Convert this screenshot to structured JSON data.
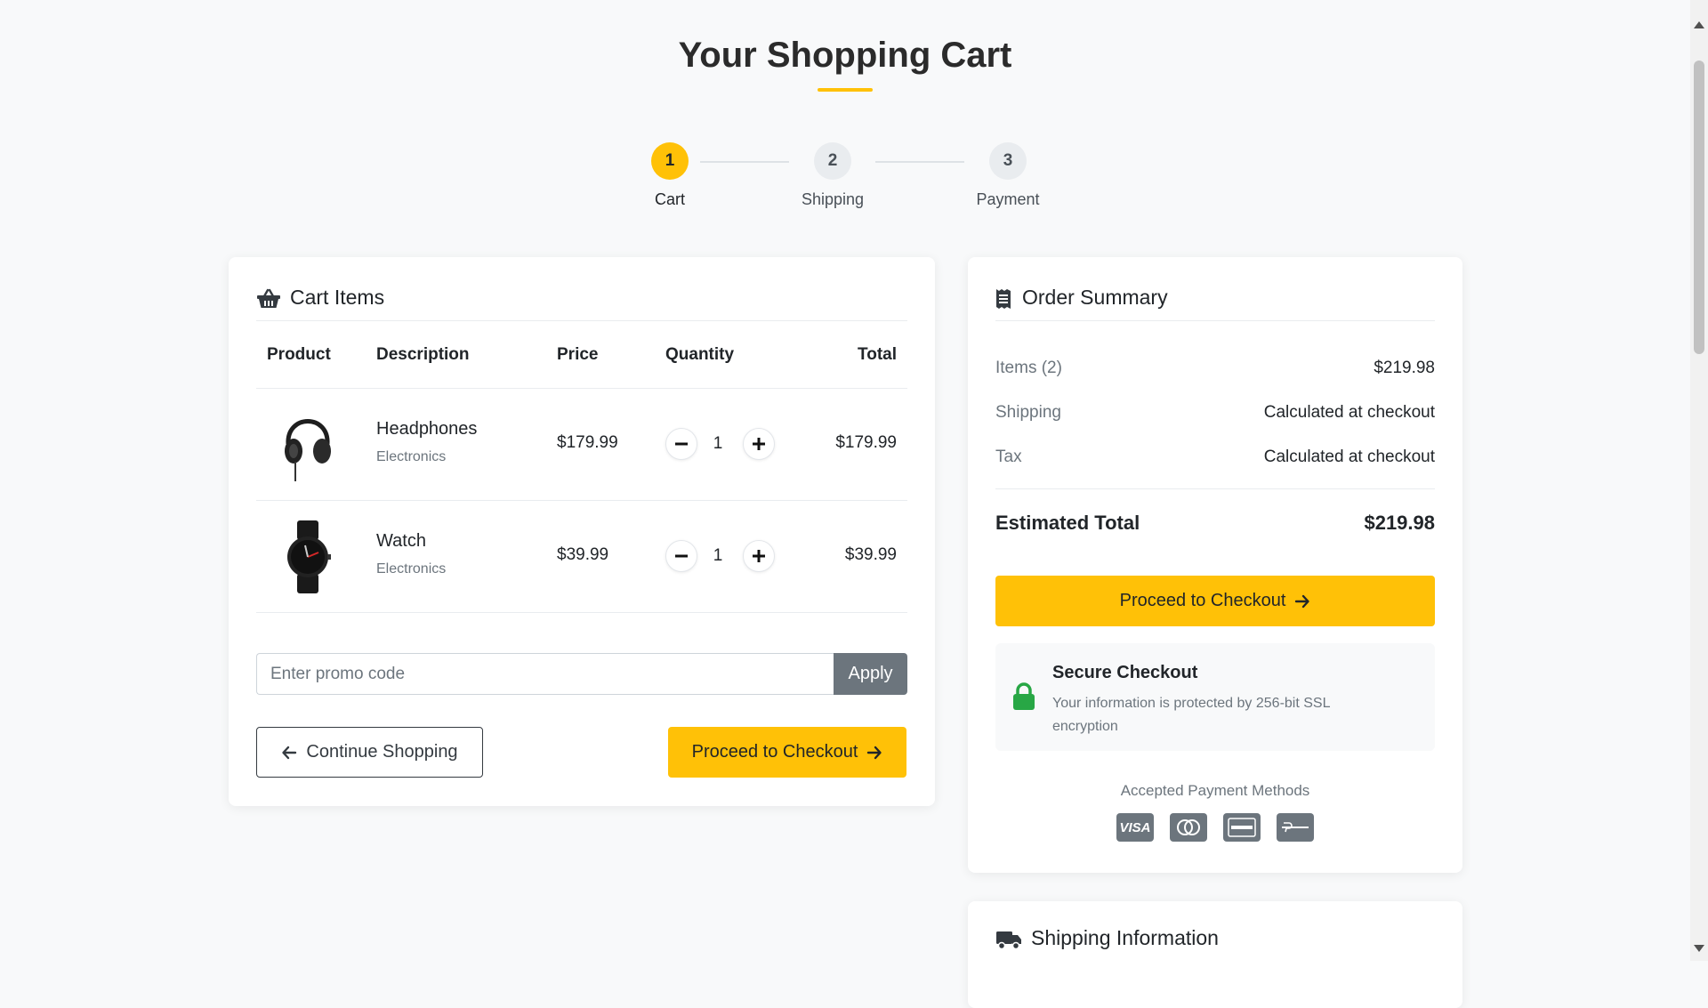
{
  "page": {
    "title": "Your Shopping Cart"
  },
  "steps": [
    {
      "number": "1",
      "label": "Cart",
      "active": true
    },
    {
      "number": "2",
      "label": "Shipping",
      "active": false
    },
    {
      "number": "3",
      "label": "Payment",
      "active": false
    }
  ],
  "cart": {
    "header": "Cart Items",
    "header_icon": "basket-icon",
    "columns": {
      "product": "Product",
      "description": "Description",
      "price": "Price",
      "quantity": "Quantity",
      "total": "Total"
    },
    "items": [
      {
        "name": "Headphones",
        "category": "Electronics",
        "price": "$179.99",
        "quantity": "1",
        "total": "$179.99",
        "image": "headphones-image"
      },
      {
        "name": "Watch",
        "category": "Electronics",
        "price": "$39.99",
        "quantity": "1",
        "total": "$39.99",
        "image": "watch-image"
      }
    ],
    "promo": {
      "placeholder": "Enter promo code",
      "value": "",
      "apply_label": "Apply"
    },
    "continue_label": "Continue Shopping",
    "checkout_label": "Proceed to Checkout"
  },
  "summary": {
    "header": "Order Summary",
    "header_icon": "receipt-icon",
    "rows": [
      {
        "label": "Items (2)",
        "value": "$219.98"
      },
      {
        "label": "Shipping",
        "value": "Calculated at checkout"
      },
      {
        "label": "Tax",
        "value": "Calculated at checkout"
      }
    ],
    "estimated_label": "Estimated Total",
    "estimated_value": "$219.98",
    "checkout_label": "Proceed to Checkout",
    "secure": {
      "title": "Secure Checkout",
      "text": "Your information is protected by 256-bit SSL encryption",
      "icon": "lock-icon"
    },
    "payment_methods_label": "Accepted Payment Methods",
    "payment_methods": [
      "visa-icon",
      "mastercard-icon",
      "amex-icon",
      "paypal-icon"
    ]
  },
  "shipping_info": {
    "header": "Shipping Information",
    "header_icon": "truck-icon"
  },
  "colors": {
    "accent": "#ffc107",
    "secondary": "#6c757d",
    "secure_green": "#28a745",
    "background": "#f8f9fa"
  }
}
